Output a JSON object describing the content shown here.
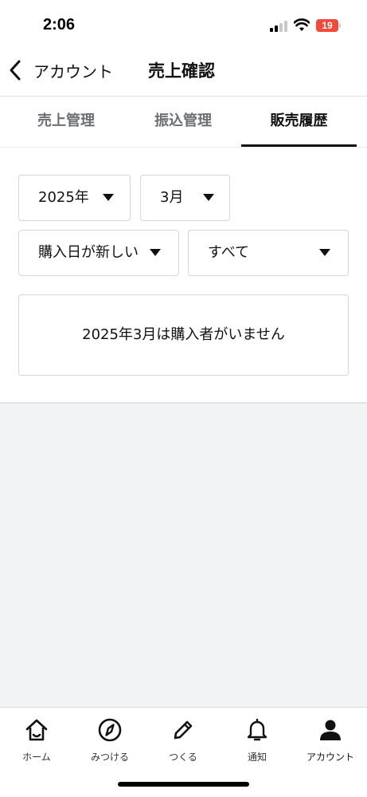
{
  "status_bar": {
    "time": "2:06",
    "battery_level": "19",
    "battery_color": "#f34a3c"
  },
  "header": {
    "back_label": "アカウント",
    "title": "売上確認"
  },
  "tabs": [
    {
      "label": "売上管理",
      "active": false
    },
    {
      "label": "振込管理",
      "active": false
    },
    {
      "label": "販売履歴",
      "active": true
    }
  ],
  "filters": {
    "year": "2025年",
    "month": "3月",
    "sort": "購入日が新しい",
    "category": "すべて"
  },
  "empty_message": "2025年3月は購入者がいません",
  "bottom_nav": [
    {
      "label": "ホーム",
      "icon": "home-icon",
      "active": false
    },
    {
      "label": "みつける",
      "icon": "compass-icon",
      "active": false
    },
    {
      "label": "つくる",
      "icon": "pencil-icon",
      "active": false
    },
    {
      "label": "通知",
      "icon": "bell-icon",
      "active": false
    },
    {
      "label": "アカウント",
      "icon": "person-icon",
      "active": true
    }
  ],
  "colors": {
    "background": "#f1f3f4",
    "active_text": "#111111",
    "inactive_tab": "#6b6f73",
    "border": "#d4d6d8"
  }
}
